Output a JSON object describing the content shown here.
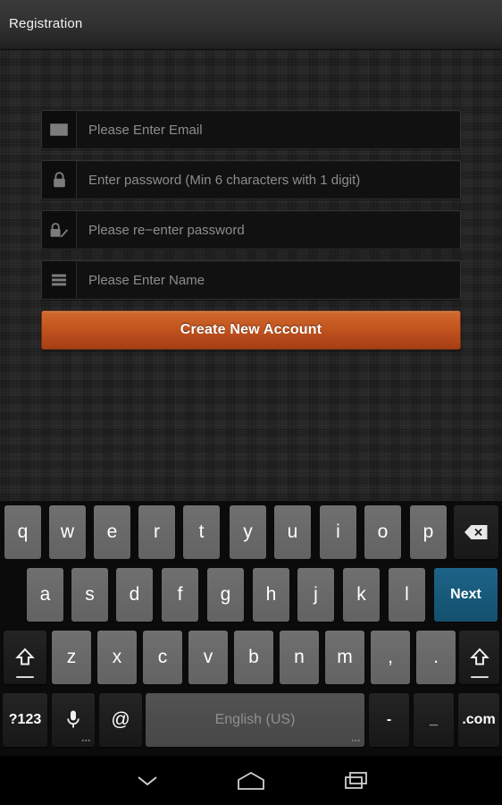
{
  "titlebar": {
    "title": "Registration"
  },
  "form": {
    "fields": [
      {
        "icon": "envelope-icon",
        "placeholder": "Please Enter Email",
        "name": "email-field"
      },
      {
        "icon": "lock-closed-icon",
        "placeholder": "Enter password (Min 6 characters with 1 digit)",
        "name": "password-field"
      },
      {
        "icon": "lock-edit-icon",
        "placeholder": "Please re−enter password",
        "name": "confirm-password-field"
      },
      {
        "icon": "list-icon",
        "placeholder": "Please Enter Name",
        "name": "name-field"
      }
    ],
    "submit_label": "Create New Account"
  },
  "keyboard": {
    "language": "English (US)",
    "row1": [
      "q",
      "w",
      "e",
      "r",
      "t",
      "y",
      "u",
      "i",
      "o",
      "p"
    ],
    "row2": [
      "a",
      "s",
      "d",
      "f",
      "g",
      "h",
      "j",
      "k",
      "l"
    ],
    "row3": [
      "z",
      "x",
      "c",
      "v",
      "b",
      "n",
      "m",
      ",",
      "."
    ],
    "backspace_label": "⌫",
    "next_label": "Next",
    "symbols_label": "?123",
    "mic_label": "mic-icon",
    "at_label": "@",
    "hyphen_label": "-",
    "underscore_label": "_",
    "dotcom_label": ".com",
    "shift_label": "shift-icon",
    "popup_dots": "▪▪▪"
  },
  "navbar": {
    "back_label": "hide-keyboard-icon",
    "home_label": "home-icon",
    "recents_label": "recents-icon"
  },
  "colors": {
    "accent_orange": "#c4561f",
    "action_blue": "#175979",
    "key_gray": "#6b6b6b",
    "background": "#232323"
  }
}
